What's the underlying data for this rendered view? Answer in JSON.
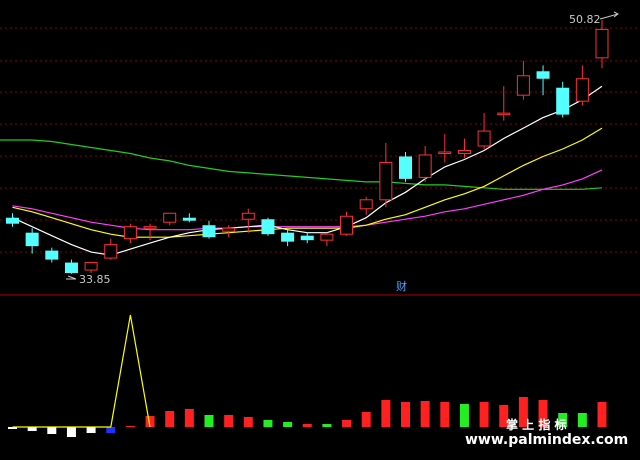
{
  "chart_data": {
    "type": "candlestick",
    "price_labels": {
      "high": "50.82",
      "low": "33.85"
    },
    "badge": "财",
    "watermark": {
      "line1": "掌 上 指 标",
      "line2": "www.palmindex.com"
    },
    "colors": {
      "up": "#ff3030",
      "down": "#54ffff",
      "flat": "#ffffff",
      "ma_short": "#ffffff",
      "ma_mid": "#ffff00",
      "ma_long": "#ff40ff",
      "ma_xlong": "#22cc22",
      "grid": "#8b0000",
      "separator": "#b00000",
      "hist_red": "#ff2020",
      "hist_green": "#22ee22",
      "hist_white": "#ffffff",
      "hist_blue": "#2030ff",
      "spike": "#ffff00",
      "watermark": "#ffffff",
      "badge": "#4aa3ff"
    },
    "candles": [
      {
        "o": 37.6,
        "h": 37.9,
        "c": 37.2,
        "l": 37.0
      },
      {
        "o": 36.6,
        "h": 36.9,
        "c": 35.7,
        "l": 35.2
      },
      {
        "o": 35.4,
        "h": 35.6,
        "c": 34.8,
        "l": 34.6
      },
      {
        "o": 34.6,
        "h": 34.8,
        "c": 33.9,
        "l": 33.85
      },
      {
        "o": 34.1,
        "h": 34.5,
        "c": 34.6,
        "l": 33.9
      },
      {
        "o": 34.9,
        "h": 36.2,
        "c": 35.8,
        "l": 34.8
      },
      {
        "o": 36.2,
        "h": 37.2,
        "c": 37.0,
        "l": 35.9
      },
      {
        "o": 36.9,
        "h": 37.2,
        "c": 37.0,
        "l": 36.1
      },
      {
        "o": 37.3,
        "h": 37.9,
        "c": 37.9,
        "l": 37.1
      },
      {
        "o": 37.6,
        "h": 37.9,
        "c": 37.4,
        "l": 37.3
      },
      {
        "o": 37.1,
        "h": 37.4,
        "c": 36.3,
        "l": 36.2
      },
      {
        "o": 36.7,
        "h": 37.1,
        "c": 36.9,
        "l": 36.3
      },
      {
        "o": 37.5,
        "h": 38.2,
        "c": 37.9,
        "l": 36.6
      },
      {
        "o": 37.5,
        "h": 37.6,
        "c": 36.5,
        "l": 36.4
      },
      {
        "o": 36.6,
        "h": 36.8,
        "c": 36.0,
        "l": 35.7
      },
      {
        "o": 36.4,
        "h": 36.6,
        "c": 36.1,
        "l": 35.9
      },
      {
        "o": 36.1,
        "h": 36.6,
        "c": 36.5,
        "l": 35.7
      },
      {
        "o": 36.5,
        "h": 38.0,
        "c": 37.7,
        "l": 36.4
      },
      {
        "o": 38.2,
        "h": 39.0,
        "c": 38.8,
        "l": 37.8
      },
      {
        "o": 38.8,
        "h": 42.6,
        "c": 41.3,
        "l": 38.3
      },
      {
        "o": 41.7,
        "h": 42.0,
        "c": 40.2,
        "l": 40.0
      },
      {
        "o": 40.3,
        "h": 42.4,
        "c": 41.8,
        "l": 40.0
      },
      {
        "o": 41.9,
        "h": 43.2,
        "c": 42.0,
        "l": 41.3
      },
      {
        "o": 41.9,
        "h": 42.9,
        "c": 42.1,
        "l": 41.6
      },
      {
        "o": 42.4,
        "h": 44.6,
        "c": 43.4,
        "l": 42.2
      },
      {
        "o": 44.5,
        "h": 46.4,
        "c": 44.6,
        "l": 44.1
      },
      {
        "o": 45.8,
        "h": 48.1,
        "c": 47.1,
        "l": 45.5
      },
      {
        "o": 47.4,
        "h": 47.8,
        "c": 46.9,
        "l": 45.8
      },
      {
        "o": 46.3,
        "h": 46.7,
        "c": 44.5,
        "l": 44.3
      },
      {
        "o": 45.4,
        "h": 47.8,
        "c": 46.9,
        "l": 45.1
      },
      {
        "o": 48.3,
        "h": 50.82,
        "c": 50.2,
        "l": 47.6
      }
    ],
    "ma_short": [
      37.6,
      37.0,
      36.4,
      35.8,
      35.3,
      35.1,
      35.5,
      35.9,
      36.3,
      36.6,
      36.8,
      36.9,
      37.0,
      37.1,
      36.8,
      36.6,
      36.6,
      37.0,
      37.6,
      38.6,
      39.3,
      40.2,
      41.0,
      41.5,
      42.1,
      42.9,
      43.6,
      44.3,
      44.8,
      45.5,
      46.4
    ],
    "ma_mid": [
      38.3,
      38.0,
      37.6,
      37.2,
      36.8,
      36.5,
      36.3,
      36.3,
      36.3,
      36.4,
      36.5,
      36.6,
      36.7,
      36.8,
      36.9,
      36.9,
      36.9,
      36.9,
      37.1,
      37.5,
      37.8,
      38.3,
      38.8,
      39.2,
      39.7,
      40.4,
      41.1,
      41.7,
      42.2,
      42.8,
      43.6
    ],
    "ma_long": [
      38.4,
      38.2,
      37.9,
      37.6,
      37.3,
      37.1,
      36.9,
      36.8,
      36.8,
      36.8,
      36.9,
      36.9,
      37.0,
      37.0,
      37.0,
      37.0,
      37.0,
      37.0,
      37.1,
      37.3,
      37.5,
      37.7,
      38.0,
      38.2,
      38.5,
      38.8,
      39.1,
      39.5,
      39.8,
      40.2,
      40.8
    ],
    "ma_xlong": [
      42.8,
      42.8,
      42.7,
      42.5,
      42.3,
      42.1,
      41.9,
      41.6,
      41.4,
      41.1,
      40.9,
      40.7,
      40.6,
      40.5,
      40.4,
      40.3,
      40.2,
      40.1,
      40.0,
      40.0,
      39.9,
      39.8,
      39.8,
      39.7,
      39.6,
      39.5,
      39.5,
      39.5,
      39.5,
      39.5,
      39.6
    ],
    "histogram": [
      {
        "v": -2,
        "c": "white"
      },
      {
        "v": -4,
        "c": "white"
      },
      {
        "v": -7,
        "c": "white"
      },
      {
        "v": -10,
        "c": "white"
      },
      {
        "v": -6,
        "c": "white"
      },
      {
        "v": -6,
        "c": "blue"
      },
      {
        "v": 1,
        "c": "red"
      },
      {
        "v": 11,
        "c": "red"
      },
      {
        "v": 16,
        "c": "red"
      },
      {
        "v": 18,
        "c": "red"
      },
      {
        "v": 12,
        "c": "green"
      },
      {
        "v": 12,
        "c": "red"
      },
      {
        "v": 10,
        "c": "red"
      },
      {
        "v": 7,
        "c": "green"
      },
      {
        "v": 5,
        "c": "green"
      },
      {
        "v": 3,
        "c": "red"
      },
      {
        "v": 3,
        "c": "green"
      },
      {
        "v": 7,
        "c": "red"
      },
      {
        "v": 15,
        "c": "red"
      },
      {
        "v": 27,
        "c": "red"
      },
      {
        "v": 25,
        "c": "red"
      },
      {
        "v": 26,
        "c": "red"
      },
      {
        "v": 25,
        "c": "red"
      },
      {
        "v": 23,
        "c": "green"
      },
      {
        "v": 25,
        "c": "red"
      },
      {
        "v": 22,
        "c": "red"
      },
      {
        "v": 30,
        "c": "red"
      },
      {
        "v": 27,
        "c": "red"
      },
      {
        "v": 14,
        "c": "green"
      },
      {
        "v": 14,
        "c": "green"
      },
      {
        "v": 25,
        "c": "red"
      }
    ],
    "spike_values": [
      0,
      0,
      0,
      0,
      0,
      0,
      100,
      0
    ]
  }
}
